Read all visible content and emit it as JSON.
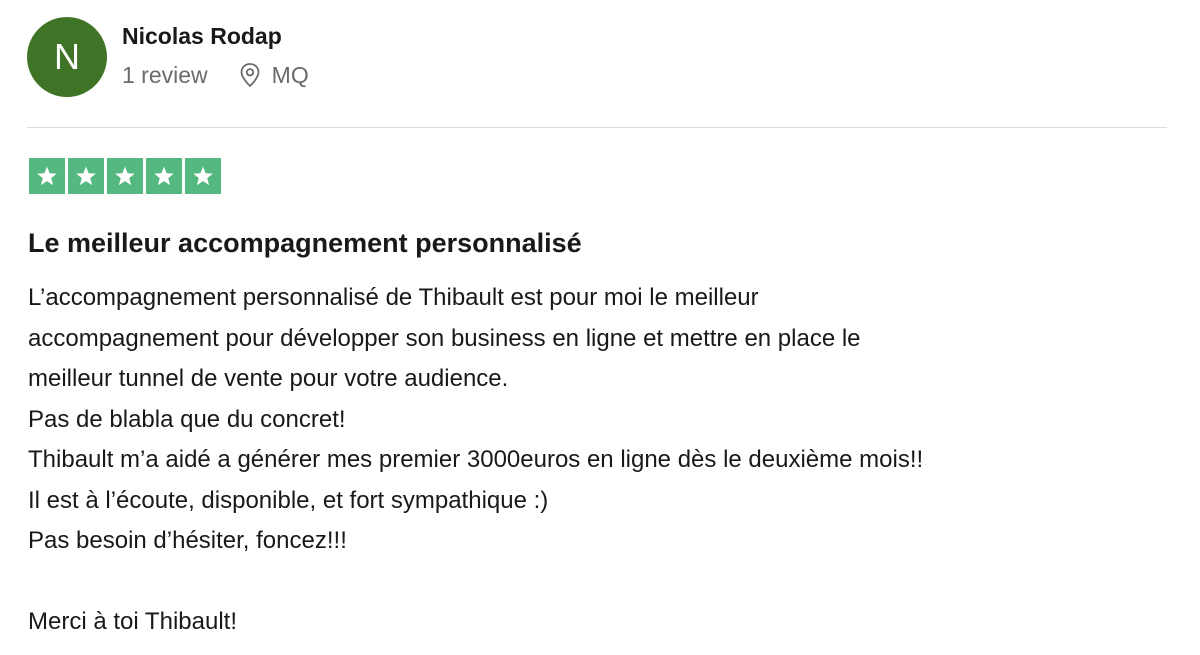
{
  "reviewer": {
    "avatar_initial": "N",
    "avatar_color": "#3f7426",
    "name": "Nicolas Rodap",
    "review_count": "1 review",
    "location": "MQ",
    "location_icon": "location-pin-icon"
  },
  "review": {
    "rating": 5,
    "max_rating": 5,
    "star_color": "#56b881",
    "title": "Le meilleur accompagnement personnalisé",
    "lines": [
      "L’accompagnement personnalisé de Thibault est pour moi le meilleur",
      "accompagnement pour développer son business en ligne et mettre en place le",
      "meilleur tunnel de vente pour votre audience.",
      "Pas de blabla que du concret!",
      "Thibault m’a aidé a générer mes premier 3000euros en ligne dès le deuxième mois!!",
      "Il est à l’écoute, disponible, et fort sympathique :)",
      "Pas besoin d’hésiter, foncez!!!",
      "",
      "Merci à toi Thibault!"
    ]
  }
}
